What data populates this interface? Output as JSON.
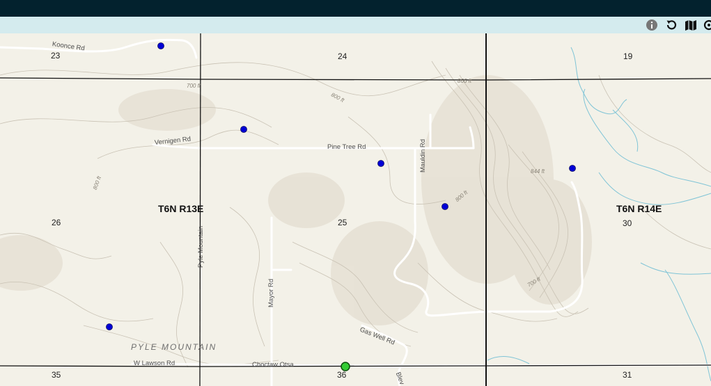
{
  "header": {
    "bar_color": "#03222e"
  },
  "toolbar": {
    "background": "#d4ebee",
    "tools": [
      {
        "name": "info",
        "icon": "info-circle-icon"
      },
      {
        "name": "reset",
        "icon": "rotate-left-icon"
      },
      {
        "name": "basemap",
        "icon": "map-icon"
      },
      {
        "name": "locate",
        "icon": "crosshair-icon"
      }
    ]
  },
  "map": {
    "sections": [
      "23",
      "24",
      "19",
      "26",
      "25",
      "30",
      "35",
      "36",
      "31"
    ],
    "townships": [
      "T6N R13E",
      "T6N R14E"
    ],
    "roads": {
      "koonce": "Koonce Rd",
      "vernigen": "Vernigen Rd",
      "pine_tree": "Pine Tree Rd",
      "mauldin": "Mauldin Rd",
      "pyle_mountain": "Pyle Mountain",
      "mayor": "Mayor Rd",
      "gas_well": "Gas Well Rd",
      "w_lawson": "W Lawson Rd",
      "choctaw": "Choctaw Otsa",
      "blev": "Blev"
    },
    "elevations": [
      "700 ft",
      "800 ft",
      "866 ft",
      "800 ft",
      "844 ft",
      "800 ft",
      "700 ft"
    ],
    "place": "PYLE MOUNTAIN",
    "colors": {
      "point": "#0000d6",
      "selected_point": "#33cc33",
      "grid": "#111111",
      "road": "#ffffff",
      "water": "#7fc4d6",
      "contour": "#c9c2b4"
    },
    "points_count": 6,
    "selected_points_count": 1
  }
}
